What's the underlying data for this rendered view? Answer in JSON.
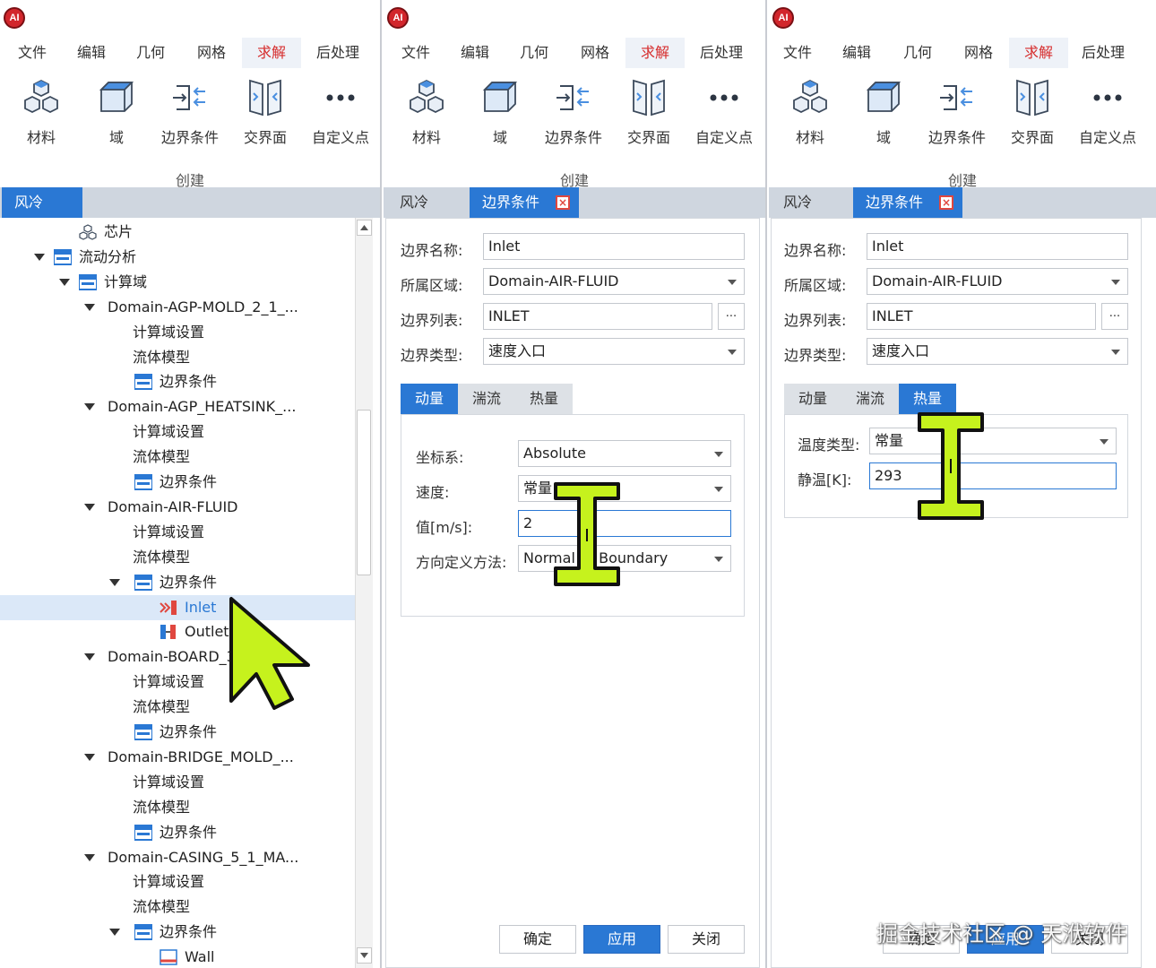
{
  "app": {
    "logo_text": "AI"
  },
  "menu": [
    "文件",
    "编辑",
    "几何",
    "网格",
    "求解",
    "后处理"
  ],
  "active_menu_index": 4,
  "ribbon": {
    "buttons": [
      {
        "label": "材料",
        "icon": "material-icon"
      },
      {
        "label": "域",
        "icon": "domain-icon"
      },
      {
        "label": "边界条件",
        "icon": "boundary-condition-icon"
      },
      {
        "label": "交界面",
        "icon": "interface-icon"
      },
      {
        "label": "自定义点",
        "icon": "custom-point-icon"
      }
    ],
    "group_label": "创建"
  },
  "left_panel": {
    "tab": "风冷",
    "tree": [
      {
        "label": "芯片",
        "level": 2,
        "icon": "material-icon"
      },
      {
        "label": "流动分析",
        "level": 1,
        "icon": "folder-icon",
        "expanded": true
      },
      {
        "label": "计算域",
        "level": 2,
        "icon": "folder-icon",
        "expanded": true
      },
      {
        "label": "Domain-AGP-MOLD_2_1_...",
        "level": 3,
        "expanded": true
      },
      {
        "label": "计算域设置",
        "level": 4
      },
      {
        "label": "流体模型",
        "level": 4
      },
      {
        "label": "边界条件",
        "level": 4,
        "icon": "folder-icon"
      },
      {
        "label": "Domain-AGP_HEATSINK_...",
        "level": 3,
        "expanded": true
      },
      {
        "label": "计算域设置",
        "level": 4
      },
      {
        "label": "流体模型",
        "level": 4
      },
      {
        "label": "边界条件",
        "level": 4,
        "icon": "folder-icon"
      },
      {
        "label": "Domain-AIR-FLUID",
        "level": 3,
        "expanded": true
      },
      {
        "label": "计算域设置",
        "level": 4
      },
      {
        "label": "流体模型",
        "level": 4
      },
      {
        "label": "边界条件",
        "level": 4,
        "icon": "folder-icon",
        "expanded": true
      },
      {
        "label": "Inlet",
        "level": 5,
        "icon": "inlet-icon",
        "selected": true
      },
      {
        "label": "Outlet",
        "level": 5,
        "icon": "outlet-icon"
      },
      {
        "label": "Domain-BOARD_3",
        "level": 3,
        "expanded": true
      },
      {
        "label": "计算域设置",
        "level": 4
      },
      {
        "label": "流体模型",
        "level": 4
      },
      {
        "label": "边界条件",
        "level": 4,
        "icon": "folder-icon"
      },
      {
        "label": "Domain-BRIDGE_MOLD_...",
        "level": 3,
        "expanded": true
      },
      {
        "label": "计算域设置",
        "level": 4
      },
      {
        "label": "流体模型",
        "level": 4
      },
      {
        "label": "边界条件",
        "level": 4,
        "icon": "folder-icon"
      },
      {
        "label": "Domain-CASING_5_1_MA...",
        "level": 3,
        "expanded": true
      },
      {
        "label": "计算域设置",
        "level": 4
      },
      {
        "label": "流体模型",
        "level": 4
      },
      {
        "label": "边界条件",
        "level": 4,
        "icon": "folder-icon",
        "expanded": true
      },
      {
        "label": "Wall",
        "level": 5,
        "icon": "wall-icon"
      }
    ]
  },
  "form_common": {
    "tab_main": "风冷",
    "tab_bc": "边界条件",
    "close_glyph": "×",
    "labels": {
      "name": "边界名称:",
      "region": "所属区域:",
      "list": "边界列表:",
      "type": "边界类型:"
    },
    "values": {
      "name": "Inlet",
      "region": "Domain-AIR-FLUID",
      "list": "INLET",
      "type": "速度入口"
    },
    "browse_label": "...",
    "subtabs": [
      "动量",
      "湍流",
      "热量"
    ]
  },
  "middle_panel": {
    "active_subtab": 0,
    "fields": [
      {
        "label": "坐标系:",
        "value": "Absolute",
        "kind": "select"
      },
      {
        "label": "速度:",
        "value": "常量",
        "kind": "select"
      },
      {
        "label": "值[m/s]:",
        "value": "2",
        "kind": "input"
      },
      {
        "label": "方向定义方法:",
        "value": "Normal to Boundary",
        "kind": "select"
      }
    ],
    "buttons": {
      "ok": "确定",
      "apply": "应用",
      "close": "关闭"
    }
  },
  "right_panel": {
    "active_subtab": 2,
    "fields": [
      {
        "label": "温度类型:",
        "value": "常量",
        "kind": "select"
      },
      {
        "label": "静温[K]:",
        "value": "293",
        "kind": "input"
      }
    ],
    "buttons": {
      "ok": "确定",
      "apply": "应用",
      "close": "关闭"
    }
  },
  "watermark": "掘金技术社区 @ 天洑软件",
  "colors": {
    "accent": "#2a78d4",
    "cursor": "#c6f21d",
    "active_menu": "#d62b2b"
  }
}
